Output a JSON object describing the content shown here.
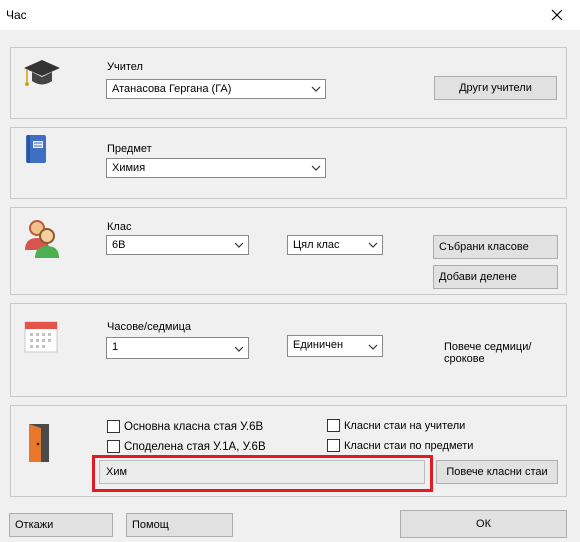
{
  "window": {
    "title": "Час"
  },
  "teacher": {
    "label": "Учител",
    "selected": "Атанасова Гергана (ГА)",
    "other_button": "Други учители"
  },
  "subject": {
    "label": "Предмет",
    "selected": "Химия"
  },
  "class_section": {
    "label": "Клас",
    "class_selected": "6В",
    "group_selected": "Цял клас",
    "joined_button": "Събрани класове",
    "add_split_button": "Добави делене"
  },
  "hours": {
    "label": "Часове/седмица",
    "count_selected": "1",
    "type_selected": "Единичен",
    "more_weeks_label": "Повече седмици/срокове"
  },
  "rooms": {
    "main_room": "Основна класна стая У.6В",
    "shared_room": "Споделена стая У.1А, У.6В",
    "teacher_rooms": "Класни стаи на учители",
    "subject_rooms": "Класни стаи по предмети",
    "room_field": "Хим",
    "more_rooms_button": "Повече класни стаи"
  },
  "footer": {
    "cancel": "Откажи",
    "help": "Помощ",
    "ok": "ОК"
  },
  "colors": {
    "highlight": "#e01b24"
  },
  "icons": [
    "close-icon",
    "graduation-cap-icon",
    "book-icon",
    "users-icon",
    "calendar-icon",
    "door-icon",
    "chevron-down-icon"
  ]
}
